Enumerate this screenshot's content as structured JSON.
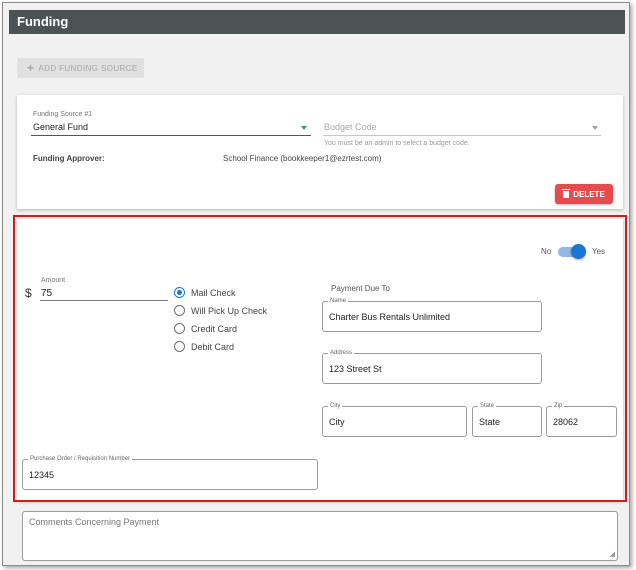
{
  "header": {
    "title": "Funding"
  },
  "toolbar": {
    "add_funding_source_label": "ADD FUNDING SOURCE"
  },
  "funding_source": {
    "label": "Funding Source #1",
    "value": "General Fund",
    "budget_code_placeholder": "Budget Code",
    "budget_code_helper": "You must be an admin to select a budget code.",
    "approver_label": "Funding Approver:",
    "approver_value": "School Finance (bookkeeper1@ezrtest.com)",
    "delete_label": "DELETE"
  },
  "toggle": {
    "no_label": "No",
    "yes_label": "Yes",
    "state": "Yes"
  },
  "amount": {
    "label": "Amount",
    "currency": "$",
    "value": "75"
  },
  "payment_method": {
    "options": [
      "Mail Check",
      "Will Pick Up Check",
      "Credit Card",
      "Debit Card"
    ],
    "selected": "Mail Check"
  },
  "payment_due_to": {
    "heading": "Payment Due To",
    "name_label": "Name",
    "name_value": "Charter Bus Rentals Unlimited",
    "address_label": "Address",
    "address_value": "123 Street St",
    "city_label": "City",
    "city_value": "City",
    "state_label": "State",
    "state_value": "State",
    "zip_label": "Zip",
    "zip_value": "28062"
  },
  "purchase_order": {
    "label": "Purchase Order / Requisition Number",
    "value": "12345"
  },
  "comments": {
    "placeholder": "Comments Concerning Payment"
  },
  "colors": {
    "accent": "#1976d2",
    "danger": "#e74c4c",
    "header_bg": "#4b5355",
    "highlight": "#cc1f1f"
  }
}
